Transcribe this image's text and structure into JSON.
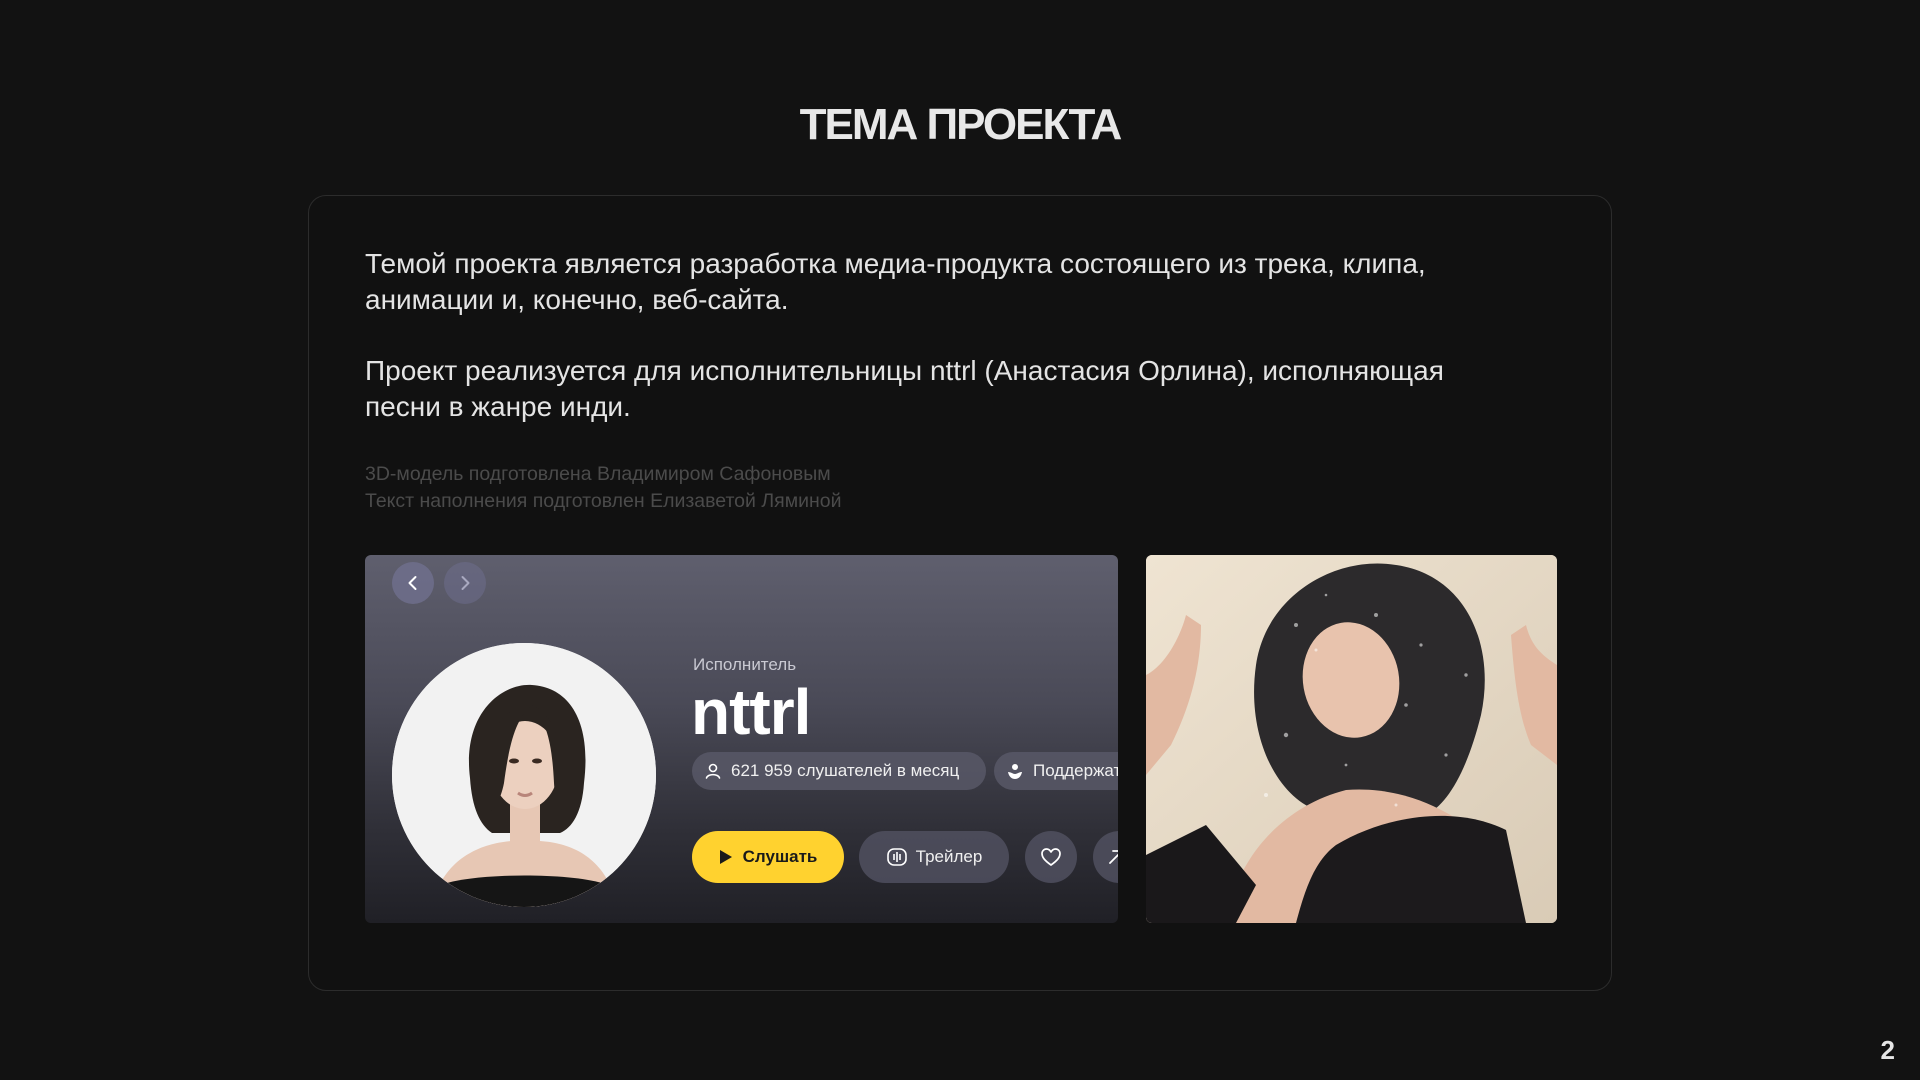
{
  "slide": {
    "title": "ТЕМА ПРОЕКТА",
    "page_number": "2"
  },
  "content": {
    "paragraph_1": "Темой проекта является разработка медиа-продукта состоящего из трека, клипа, анимации и, конечно, веб-сайта.",
    "paragraph_2": "Проект реализуется для исполнительницы nttrl (Анастасия Орлина), исполняющая песни в жанре инди.",
    "credits": [
      "3D-модель подготовлена Владимиром Сафоновым",
      "Текст наполнения подготовлен Елизаветой Ляминой"
    ]
  },
  "artist_card": {
    "type_label": "Исполнитель",
    "name": "nttrl",
    "listeners": "621 959 слушателей в месяц",
    "support": "Поддержать",
    "listen_button": "Слушать",
    "trailer_button": "Трейлер",
    "accent_color": "#ffd22f"
  },
  "icons": [
    "chevron-left-icon",
    "chevron-right-icon",
    "user-icon",
    "donate-icon",
    "play-icon",
    "waveform-icon",
    "heart-icon",
    "share-icon"
  ]
}
